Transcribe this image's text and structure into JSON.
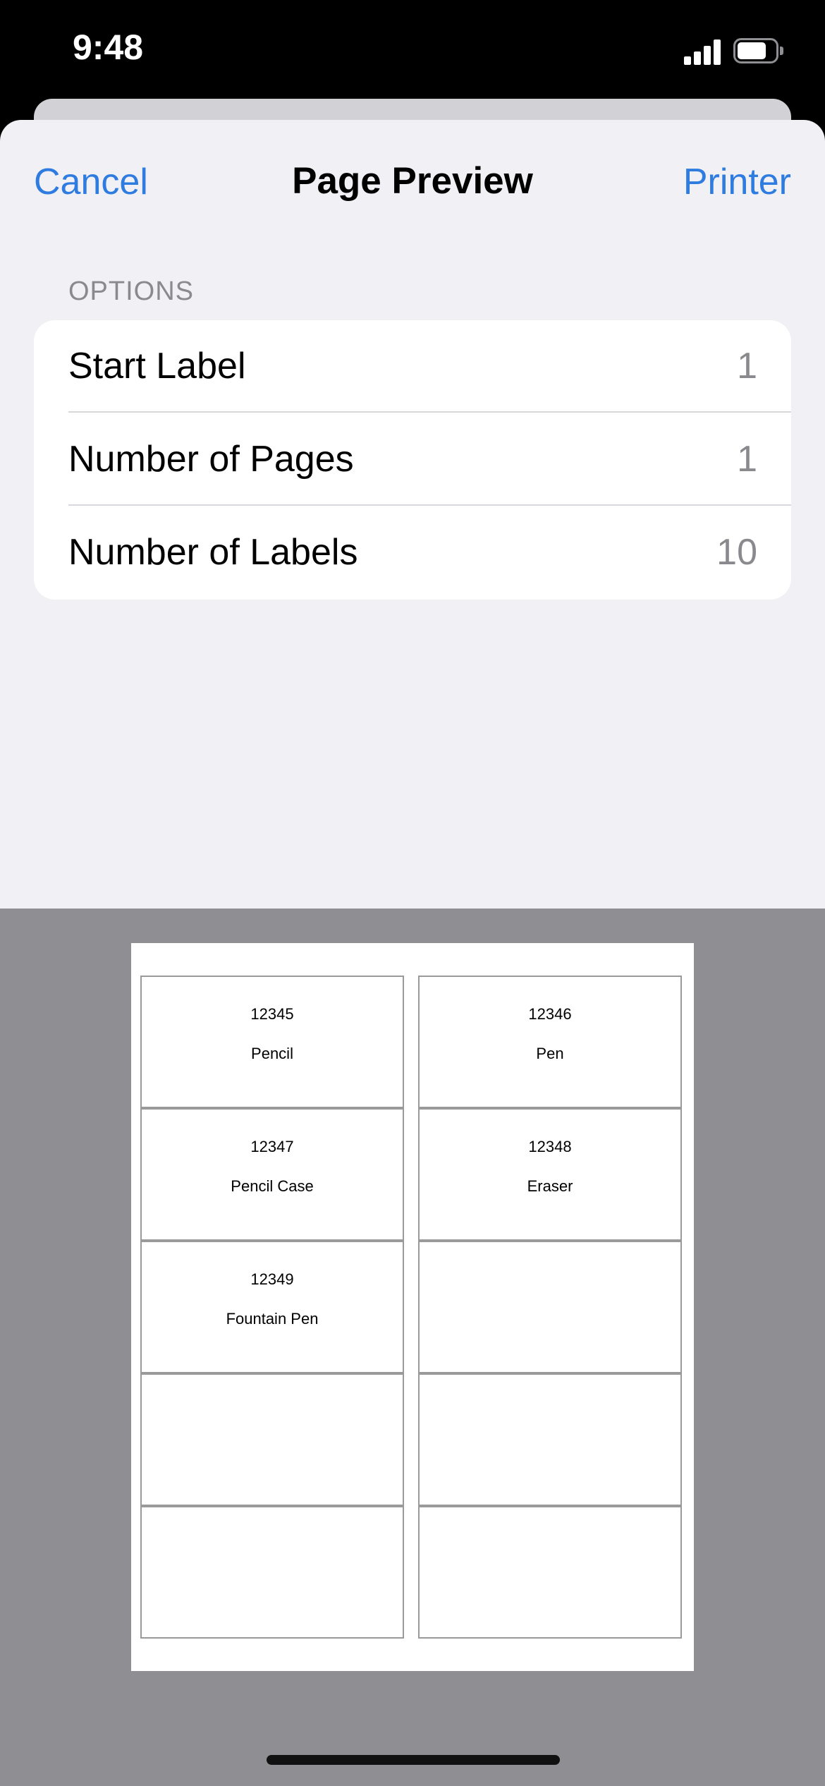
{
  "status_bar": {
    "time": "9:48"
  },
  "nav": {
    "cancel": "Cancel",
    "title": "Page Preview",
    "printer": "Printer",
    "accent_color": "#2f7ce0"
  },
  "options": {
    "header": "OPTIONS",
    "rows": [
      {
        "label": "Start Label",
        "value": "1"
      },
      {
        "label": "Number of Pages",
        "value": "1"
      },
      {
        "label": "Number of Labels",
        "value": "10"
      }
    ]
  },
  "preview": {
    "labels": [
      {
        "code": "12345",
        "name": "Pencil"
      },
      {
        "code": "12346",
        "name": "Pen"
      },
      {
        "code": "12347",
        "name": "Pencil Case"
      },
      {
        "code": "12348",
        "name": "Eraser"
      },
      {
        "code": "12349",
        "name": "Fountain Pen"
      },
      {
        "code": "",
        "name": ""
      },
      {
        "code": "",
        "name": ""
      },
      {
        "code": "",
        "name": ""
      },
      {
        "code": "",
        "name": ""
      },
      {
        "code": "",
        "name": ""
      }
    ]
  }
}
